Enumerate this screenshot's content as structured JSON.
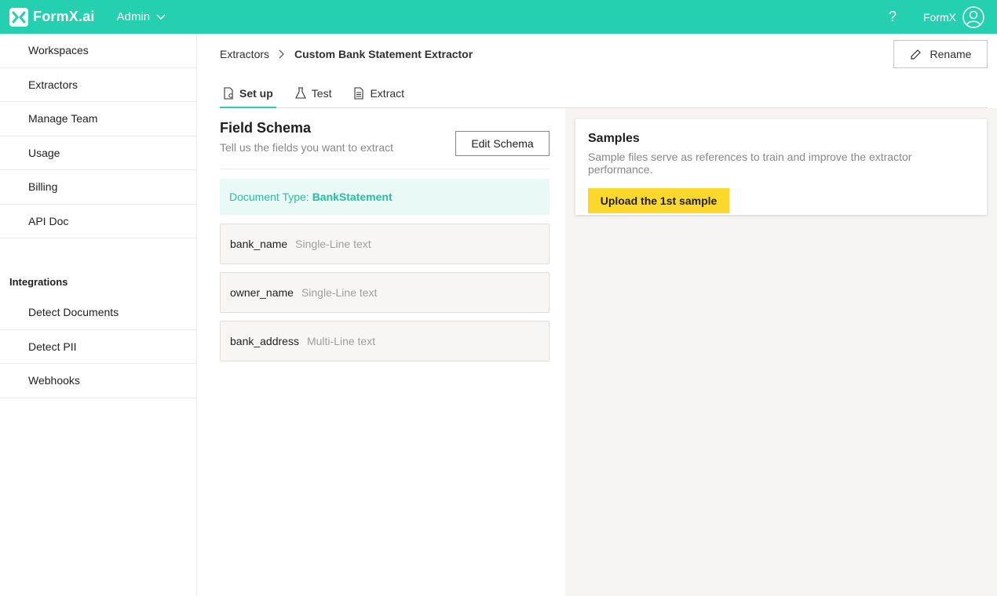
{
  "app": {
    "logo_text": "FormX.ai",
    "admin_label": "Admin",
    "user_name": "FormX"
  },
  "sidebar": {
    "items": [
      {
        "label": "Workspaces"
      },
      {
        "label": "Extractors"
      },
      {
        "label": "Manage Team"
      },
      {
        "label": "Usage"
      },
      {
        "label": "Billing"
      },
      {
        "label": "API Doc"
      }
    ],
    "integrations_title": "Integrations",
    "integrations": [
      {
        "label": "Detect Documents"
      },
      {
        "label": "Detect PII"
      },
      {
        "label": "Webhooks"
      }
    ]
  },
  "breadcrumb": {
    "parent": "Extractors",
    "current": "Custom Bank Statement Extractor"
  },
  "rename_label": "Rename",
  "tabs": [
    {
      "label": "Set up",
      "icon": "setup-icon"
    },
    {
      "label": "Test",
      "icon": "flask-icon"
    },
    {
      "label": "Extract",
      "icon": "document-icon"
    }
  ],
  "schema": {
    "title": "Field Schema",
    "subtitle": "Tell us the fields you want to extract",
    "edit_label": "Edit Schema",
    "doc_type_label": "Document Type:",
    "doc_type_value": "BankStatement",
    "fields": [
      {
        "name": "bank_name",
        "type": "Single-Line text"
      },
      {
        "name": "owner_name",
        "type": "Single-Line text"
      },
      {
        "name": "bank_address",
        "type": "Multi-Line text"
      }
    ]
  },
  "samples": {
    "title": "Samples",
    "description": "Sample files serve as references to train and improve the extractor performance.",
    "upload_label": "Upload the 1st sample"
  },
  "colors": {
    "brand": "#25d0b1",
    "upload_button": "#fdd82c",
    "doc_type_bg": "#e9f9f5"
  }
}
